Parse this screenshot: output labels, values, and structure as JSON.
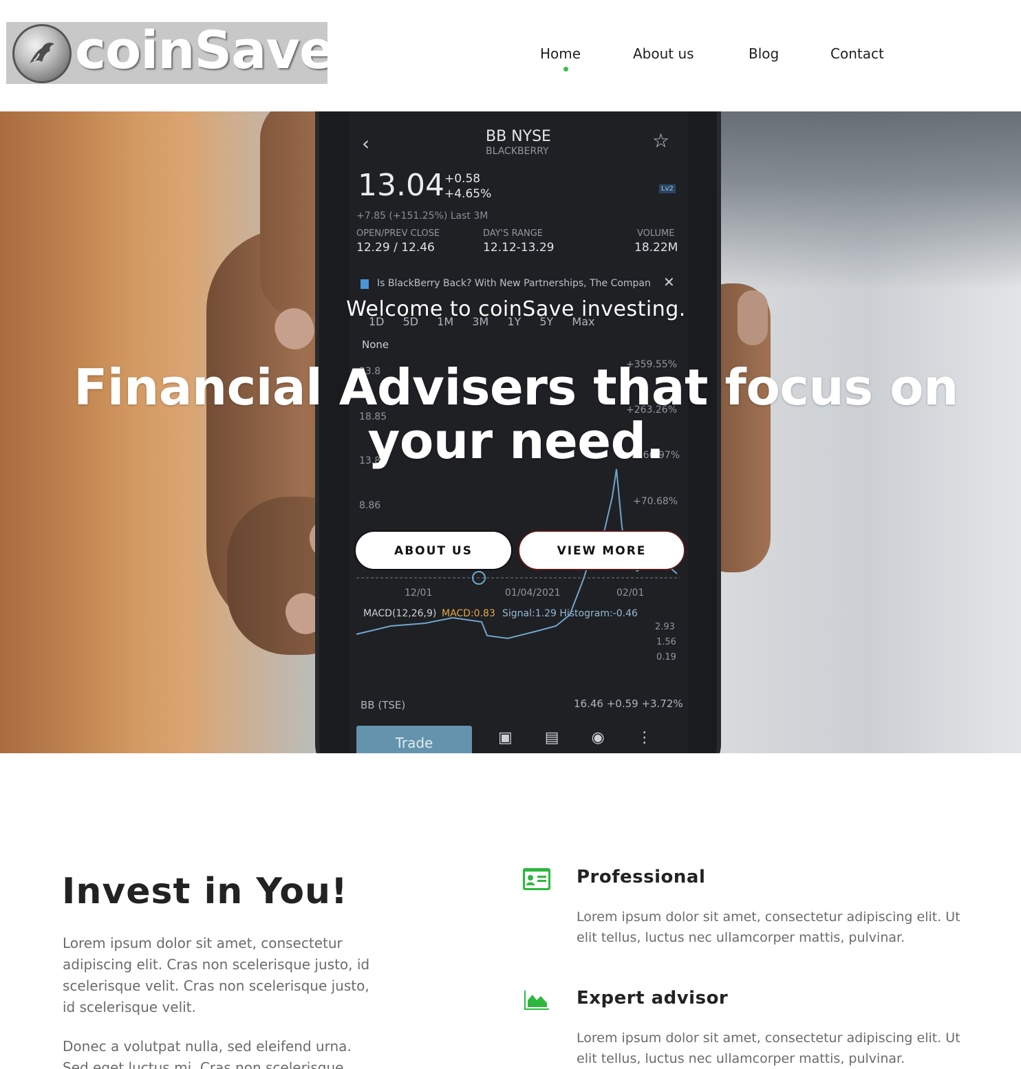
{
  "brand": {
    "name": "coinSave",
    "accent_color": "#3fbf48"
  },
  "nav": {
    "items": [
      {
        "label": "Home",
        "active": true
      },
      {
        "label": "About us",
        "active": false
      },
      {
        "label": "Blog",
        "active": false
      },
      {
        "label": "Contact",
        "active": false
      }
    ]
  },
  "hero": {
    "welcome": "Welcome to coinSave investing.",
    "headline": "Financial Advisers that focus on your need.",
    "buttons": {
      "about": "ABOUT US",
      "more": "VIEW MORE"
    },
    "phone_screen": {
      "ticker": "BB NYSE",
      "company": "BLACKBERRY",
      "price": "13.04",
      "change_abs": "+0.58",
      "change_pct": "+4.65%",
      "period_change": "+7.85 (+151.25%) Last 3M",
      "open_prev_label": "OPEN/PREV CLOSE",
      "open_prev_value": "12.29 / 12.46",
      "range_label": "DAY'S RANGE",
      "range_value": "12.12-13.29",
      "volume_label": "VOLUME",
      "volume_value": "18.22M",
      "news": "Is BlackBerry Back? With New Partnerships, The Compan",
      "periods": [
        "1D",
        "5D",
        "1M",
        "3M",
        "1Y",
        "5Y",
        "Max"
      ],
      "indicator": "None",
      "y_labels": [
        "23.8",
        "18.85",
        "13.86",
        "8.86"
      ],
      "pct_labels": [
        "+359.55%",
        "+263.26%",
        "+166.97%",
        "+70.68%"
      ],
      "dates": [
        "12/01",
        "01/04/2021",
        "02/01"
      ],
      "macd": "MACD(12,26,9)",
      "macd_value": "MACD:0.83",
      "signal": "Signal:1.29 Histogram:-0.46",
      "macd_axis": [
        "2.93",
        "1.56",
        "0.19"
      ],
      "tse_label": "BB (TSE)",
      "tse_value": "16.46 +0.59 +3.72%",
      "trade": "Trade"
    }
  },
  "intro": {
    "title": "Invest in You!",
    "paragraph1": "Lorem ipsum dolor sit amet, consectetur adipiscing elit. Cras non scelerisque justo, id scelerisque velit. Cras non scelerisque justo, id scelerisque velit.",
    "paragraph2": "Donec a volutpat nulla, sed eleifend urna. Sed eget luctus mi. Cras non scelerisque"
  },
  "features": [
    {
      "icon": "id-card-icon",
      "title": "Professional",
      "text": "Lorem ipsum dolor sit amet, consectetur adipiscing elit. Ut elit tellus, luctus nec ullamcorper mattis, pulvinar."
    },
    {
      "icon": "area-chart-icon",
      "title": "Expert advisor",
      "text": "Lorem ipsum dolor sit amet, consectetur adipiscing elit. Ut elit tellus, luctus nec ullamcorper mattis, pulvinar."
    }
  ]
}
